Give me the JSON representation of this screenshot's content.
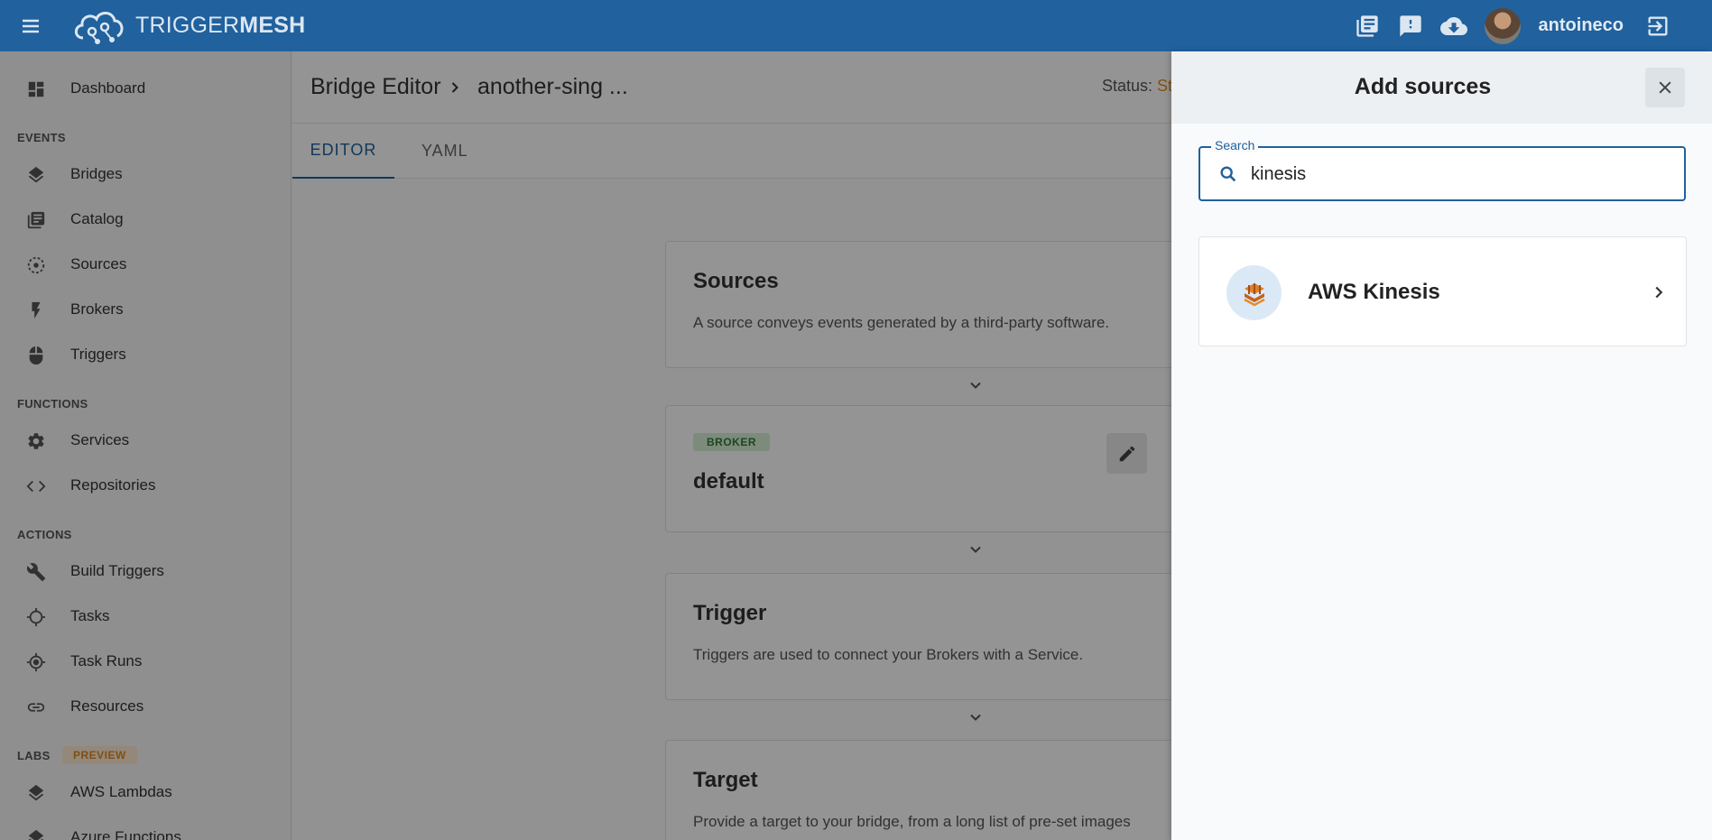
{
  "appbar": {
    "logo_light": "TRIGGER",
    "logo_bold": "MESH",
    "username": "antoineco"
  },
  "sidebar": {
    "dashboard": "Dashboard",
    "sections": {
      "events": "EVENTS",
      "functions": "FUNCTIONS",
      "actions": "ACTIONS",
      "labs": "LABS",
      "preview": "PREVIEW"
    },
    "events_items": [
      "Bridges",
      "Catalog",
      "Sources",
      "Brokers",
      "Triggers"
    ],
    "functions_items": [
      "Services",
      "Repositories"
    ],
    "actions_items": [
      "Build Triggers",
      "Tasks",
      "Task Runs",
      "Resources"
    ],
    "labs_items": [
      "AWS Lambdas",
      "Azure Functions"
    ]
  },
  "main": {
    "breadcrumb_root": "Bridge Editor",
    "breadcrumb_current": "another-sing ...",
    "status_label": "Status:",
    "status_value": "St",
    "tabs": [
      "EDITOR",
      "YAML"
    ],
    "cards": {
      "sources_title": "Sources",
      "sources_desc": "A source conveys events generated by a third-party software.",
      "broker_badge": "BROKER",
      "broker_name": "default",
      "trigger_title": "Trigger",
      "trigger_desc": "Triggers are used to connect your Brokers with a Service.",
      "target_title": "Target",
      "target_desc": "Provide a target to your bridge, from a long list of pre-set images"
    }
  },
  "drawer": {
    "title": "Add sources",
    "search_label": "Search",
    "search_value": "kinesis",
    "results": [
      {
        "label": "AWS Kinesis",
        "icon": "aws-kinesis-icon"
      }
    ]
  },
  "colors": {
    "appbar": "#20619e",
    "accent": "#20619e",
    "status_pending": "#e58a1a",
    "broker_badge_bg": "#d8efd8",
    "preview_badge_bg": "#fdebd3"
  }
}
